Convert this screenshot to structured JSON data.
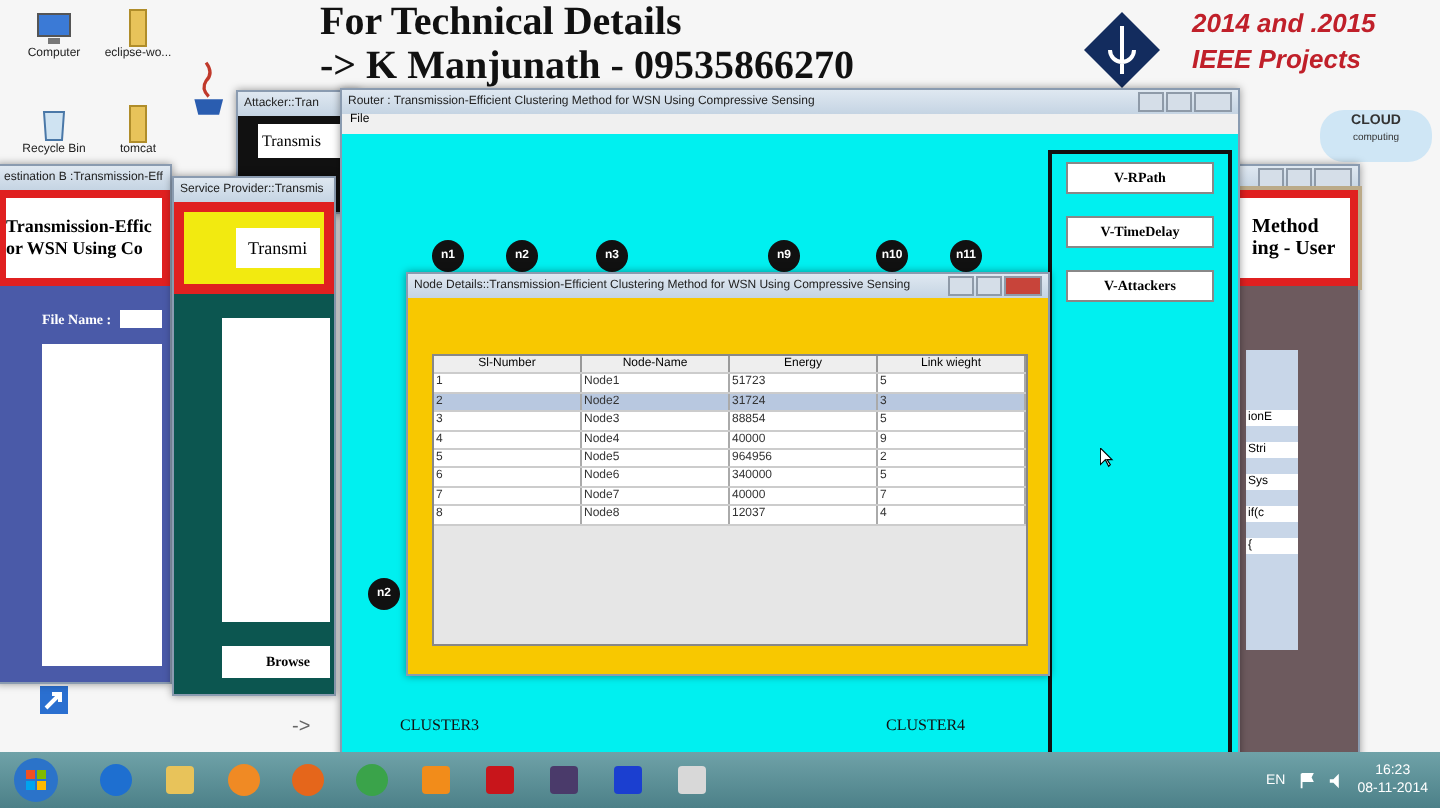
{
  "desktop": {
    "banner_lines": [
      "For Technical Details",
      "-> K Manjunath - 09535866270"
    ],
    "promo_lines": [
      "2014 and .2015",
      "IEEE Projects"
    ],
    "cloud_logo": [
      "CLOUD",
      "computing"
    ],
    "icons": [
      {
        "label": "Computer",
        "kind": "computer"
      },
      {
        "label": "eclipse-wo...",
        "kind": "folder"
      },
      {
        "label": "Recycle Bin",
        "kind": "bin"
      },
      {
        "label": "tomcat",
        "kind": "folder"
      },
      {
        "kind": "shortcut"
      }
    ],
    "arrow_text": "->"
  },
  "destination_window": {
    "title": "estination B :Transmission-Eff",
    "header_lines": [
      "Transmission-Effic",
      "or WSN Using Co"
    ],
    "file_label": "File Name :"
  },
  "user_window": {
    "header_lines": [
      "Method",
      "ing - User"
    ],
    "code_lines": [
      "ionE",
      "Stri",
      "Sys",
      "if(c",
      "{"
    ]
  },
  "service_provider_window": {
    "title": "Service Provider::Transmis",
    "header": "Transmi",
    "browse_button": "Browse"
  },
  "attacker_window": {
    "title": "Attacker::Tran",
    "header": "Transmis"
  },
  "router_window": {
    "title": "Router : Transmission-Efficient Clustering Method for WSN Using Compressive Sensing",
    "menu": [
      "File"
    ],
    "nodes": [
      "n1",
      "n2",
      "n3",
      "n9",
      "n10",
      "n11",
      "n2"
    ],
    "clusters": [
      "CLUSTER3",
      "CLUSTER4"
    ],
    "buttons": [
      "V-RPath",
      "V-TimeDelay",
      "V-Attackers"
    ]
  },
  "node_details_window": {
    "title": "Node Details::Transmission-Efficient Clustering Method for WSN Using Compressive Sensing",
    "table": {
      "columns": [
        "Sl-Number",
        "Node-Name",
        "Energy",
        "Link wieght"
      ],
      "rows": [
        {
          "cells": [
            "1",
            "Node1",
            "51723",
            "5"
          ],
          "selected": false
        },
        {
          "cells": [
            "2",
            "Node2",
            "31724",
            "3"
          ],
          "selected": true
        },
        {
          "cells": [
            "3",
            "Node3",
            "88854",
            "5"
          ],
          "selected": false
        },
        {
          "cells": [
            "4",
            "Node4",
            "40000",
            "9"
          ],
          "selected": false
        },
        {
          "cells": [
            "5",
            "Node5",
            "964956",
            "2"
          ],
          "selected": false
        },
        {
          "cells": [
            "6",
            "Node6",
            "340000",
            "5"
          ],
          "selected": false
        },
        {
          "cells": [
            "7",
            "Node7",
            "40000",
            "7"
          ],
          "selected": false
        },
        {
          "cells": [
            "8",
            "Node8",
            "12037",
            "4"
          ],
          "selected": false
        }
      ]
    }
  },
  "taskbar": {
    "language": "EN",
    "time": "16:23",
    "date": "08-11-2014"
  }
}
